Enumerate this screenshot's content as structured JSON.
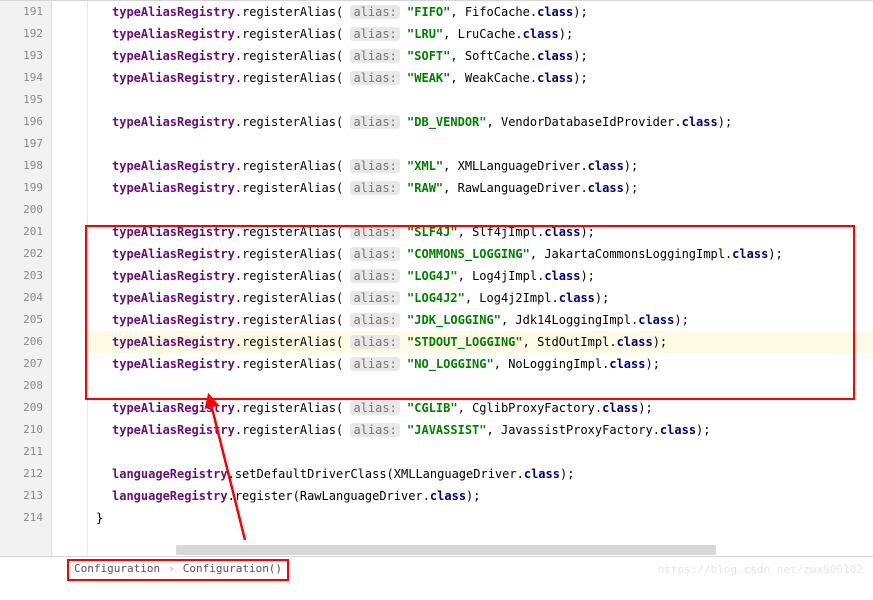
{
  "watermark": "https://blog.csdn.net/zwx900102",
  "breadcrumb": {
    "items": [
      "Configuration",
      "Configuration()"
    ]
  },
  "gutter": {
    "start": 191,
    "end": 214
  },
  "hints": {
    "alias": "alias:"
  },
  "code": [
    {
      "n": 191,
      "seg": [
        {
          "t": "field",
          "v": "typeAliasRegistry"
        },
        {
          "t": "p",
          "v": "."
        },
        {
          "t": "m",
          "v": "registerAlias"
        },
        {
          "t": "p",
          "v": "( "
        },
        {
          "t": "hint",
          "v": "alias"
        },
        {
          "t": "p",
          "v": " "
        },
        {
          "t": "s",
          "v": "\"FIFO\""
        },
        {
          "t": "p",
          "v": ", "
        },
        {
          "t": "c",
          "v": "FifoCache"
        },
        {
          "t": "p",
          "v": "."
        },
        {
          "t": "k",
          "v": "class"
        },
        {
          "t": "p",
          "v": ");"
        }
      ]
    },
    {
      "n": 192,
      "seg": [
        {
          "t": "field",
          "v": "typeAliasRegistry"
        },
        {
          "t": "p",
          "v": "."
        },
        {
          "t": "m",
          "v": "registerAlias"
        },
        {
          "t": "p",
          "v": "( "
        },
        {
          "t": "hint",
          "v": "alias"
        },
        {
          "t": "p",
          "v": " "
        },
        {
          "t": "s",
          "v": "\"LRU\""
        },
        {
          "t": "p",
          "v": ", "
        },
        {
          "t": "c",
          "v": "LruCache"
        },
        {
          "t": "p",
          "v": "."
        },
        {
          "t": "k",
          "v": "class"
        },
        {
          "t": "p",
          "v": ");"
        }
      ]
    },
    {
      "n": 193,
      "seg": [
        {
          "t": "field",
          "v": "typeAliasRegistry"
        },
        {
          "t": "p",
          "v": "."
        },
        {
          "t": "m",
          "v": "registerAlias"
        },
        {
          "t": "p",
          "v": "( "
        },
        {
          "t": "hint",
          "v": "alias"
        },
        {
          "t": "p",
          "v": " "
        },
        {
          "t": "s",
          "v": "\"SOFT\""
        },
        {
          "t": "p",
          "v": ", "
        },
        {
          "t": "c",
          "v": "SoftCache"
        },
        {
          "t": "p",
          "v": "."
        },
        {
          "t": "k",
          "v": "class"
        },
        {
          "t": "p",
          "v": ");"
        }
      ]
    },
    {
      "n": 194,
      "seg": [
        {
          "t": "field",
          "v": "typeAliasRegistry"
        },
        {
          "t": "p",
          "v": "."
        },
        {
          "t": "m",
          "v": "registerAlias"
        },
        {
          "t": "p",
          "v": "( "
        },
        {
          "t": "hint",
          "v": "alias"
        },
        {
          "t": "p",
          "v": " "
        },
        {
          "t": "s",
          "v": "\"WEAK\""
        },
        {
          "t": "p",
          "v": ", "
        },
        {
          "t": "c",
          "v": "WeakCache"
        },
        {
          "t": "p",
          "v": "."
        },
        {
          "t": "k",
          "v": "class"
        },
        {
          "t": "p",
          "v": ");"
        }
      ]
    },
    {
      "n": 195,
      "seg": []
    },
    {
      "n": 196,
      "seg": [
        {
          "t": "field",
          "v": "typeAliasRegistry"
        },
        {
          "t": "p",
          "v": "."
        },
        {
          "t": "m",
          "v": "registerAlias"
        },
        {
          "t": "p",
          "v": "( "
        },
        {
          "t": "hint",
          "v": "alias"
        },
        {
          "t": "p",
          "v": " "
        },
        {
          "t": "s",
          "v": "\"DB_VENDOR\""
        },
        {
          "t": "p",
          "v": ", "
        },
        {
          "t": "c",
          "v": "VendorDatabaseIdProvider"
        },
        {
          "t": "p",
          "v": "."
        },
        {
          "t": "k",
          "v": "class"
        },
        {
          "t": "p",
          "v": ");"
        }
      ]
    },
    {
      "n": 197,
      "seg": []
    },
    {
      "n": 198,
      "seg": [
        {
          "t": "field",
          "v": "typeAliasRegistry"
        },
        {
          "t": "p",
          "v": "."
        },
        {
          "t": "m",
          "v": "registerAlias"
        },
        {
          "t": "p",
          "v": "( "
        },
        {
          "t": "hint",
          "v": "alias"
        },
        {
          "t": "p",
          "v": " "
        },
        {
          "t": "s",
          "v": "\"XML\""
        },
        {
          "t": "p",
          "v": ", "
        },
        {
          "t": "c",
          "v": "XMLLanguageDriver"
        },
        {
          "t": "p",
          "v": "."
        },
        {
          "t": "k",
          "v": "class"
        },
        {
          "t": "p",
          "v": ");"
        }
      ]
    },
    {
      "n": 199,
      "seg": [
        {
          "t": "field",
          "v": "typeAliasRegistry"
        },
        {
          "t": "p",
          "v": "."
        },
        {
          "t": "m",
          "v": "registerAlias"
        },
        {
          "t": "p",
          "v": "( "
        },
        {
          "t": "hint",
          "v": "alias"
        },
        {
          "t": "p",
          "v": " "
        },
        {
          "t": "s",
          "v": "\"RAW\""
        },
        {
          "t": "p",
          "v": ", "
        },
        {
          "t": "c",
          "v": "RawLanguageDriver"
        },
        {
          "t": "p",
          "v": "."
        },
        {
          "t": "k",
          "v": "class"
        },
        {
          "t": "p",
          "v": ");"
        }
      ]
    },
    {
      "n": 200,
      "seg": []
    },
    {
      "n": 201,
      "seg": [
        {
          "t": "field",
          "v": "typeAliasRegistry"
        },
        {
          "t": "p",
          "v": "."
        },
        {
          "t": "m",
          "v": "registerAlias"
        },
        {
          "t": "p",
          "v": "( "
        },
        {
          "t": "hint",
          "v": "alias"
        },
        {
          "t": "p",
          "v": " "
        },
        {
          "t": "s",
          "v": "\"SLF4J\""
        },
        {
          "t": "p",
          "v": ", "
        },
        {
          "t": "c",
          "v": "Slf4jImpl"
        },
        {
          "t": "p",
          "v": "."
        },
        {
          "t": "k",
          "v": "class"
        },
        {
          "t": "p",
          "v": ");"
        }
      ]
    },
    {
      "n": 202,
      "seg": [
        {
          "t": "field",
          "v": "typeAliasRegistry"
        },
        {
          "t": "p",
          "v": "."
        },
        {
          "t": "m",
          "v": "registerAlias"
        },
        {
          "t": "p",
          "v": "( "
        },
        {
          "t": "hint",
          "v": "alias"
        },
        {
          "t": "p",
          "v": " "
        },
        {
          "t": "s",
          "v": "\"COMMONS_LOGGING\""
        },
        {
          "t": "p",
          "v": ", "
        },
        {
          "t": "c",
          "v": "JakartaCommonsLoggingImpl"
        },
        {
          "t": "p",
          "v": "."
        },
        {
          "t": "k",
          "v": "class"
        },
        {
          "t": "p",
          "v": ");"
        }
      ]
    },
    {
      "n": 203,
      "seg": [
        {
          "t": "field",
          "v": "typeAliasRegistry"
        },
        {
          "t": "p",
          "v": "."
        },
        {
          "t": "m",
          "v": "registerAlias"
        },
        {
          "t": "p",
          "v": "( "
        },
        {
          "t": "hint",
          "v": "alias"
        },
        {
          "t": "p",
          "v": " "
        },
        {
          "t": "s",
          "v": "\"LOG4J\""
        },
        {
          "t": "p",
          "v": ", "
        },
        {
          "t": "c",
          "v": "Log4jImpl"
        },
        {
          "t": "p",
          "v": "."
        },
        {
          "t": "k",
          "v": "class"
        },
        {
          "t": "p",
          "v": ");"
        }
      ]
    },
    {
      "n": 204,
      "seg": [
        {
          "t": "field",
          "v": "typeAliasRegistry"
        },
        {
          "t": "p",
          "v": "."
        },
        {
          "t": "m",
          "v": "registerAlias"
        },
        {
          "t": "p",
          "v": "( "
        },
        {
          "t": "hint",
          "v": "alias"
        },
        {
          "t": "p",
          "v": " "
        },
        {
          "t": "s",
          "v": "\"LOG4J2\""
        },
        {
          "t": "p",
          "v": ", "
        },
        {
          "t": "c",
          "v": "Log4j2Impl"
        },
        {
          "t": "p",
          "v": "."
        },
        {
          "t": "k",
          "v": "class"
        },
        {
          "t": "p",
          "v": ");"
        }
      ]
    },
    {
      "n": 205,
      "seg": [
        {
          "t": "field",
          "v": "typeAliasRegistry"
        },
        {
          "t": "p",
          "v": "."
        },
        {
          "t": "m",
          "v": "registerAlias"
        },
        {
          "t": "p",
          "v": "( "
        },
        {
          "t": "hint",
          "v": "alias"
        },
        {
          "t": "p",
          "v": " "
        },
        {
          "t": "s",
          "v": "\"JDK_LOGGING\""
        },
        {
          "t": "p",
          "v": ", "
        },
        {
          "t": "c",
          "v": "Jdk14LoggingImpl"
        },
        {
          "t": "p",
          "v": "."
        },
        {
          "t": "k",
          "v": "class"
        },
        {
          "t": "p",
          "v": ");"
        }
      ]
    },
    {
      "n": 206,
      "hl": true,
      "seg": [
        {
          "t": "field",
          "v": "typeAliasRegistry"
        },
        {
          "t": "p",
          "v": "."
        },
        {
          "t": "m",
          "v": "registerAlias"
        },
        {
          "t": "p",
          "v": "( "
        },
        {
          "t": "hint",
          "v": "alias"
        },
        {
          "t": "p",
          "v": " "
        },
        {
          "t": "s",
          "v": "\"STDOUT_LOGGING\""
        },
        {
          "t": "p",
          "v": ", "
        },
        {
          "t": "c",
          "v": "StdOutImpl"
        },
        {
          "t": "p",
          "v": "."
        },
        {
          "t": "k",
          "v": "class"
        },
        {
          "t": "p",
          "v": ");"
        }
      ]
    },
    {
      "n": 207,
      "seg": [
        {
          "t": "field",
          "v": "typeAliasRegistry"
        },
        {
          "t": "p",
          "v": "."
        },
        {
          "t": "m",
          "v": "registerAlias"
        },
        {
          "t": "p",
          "v": "( "
        },
        {
          "t": "hint",
          "v": "alias"
        },
        {
          "t": "p",
          "v": " "
        },
        {
          "t": "s",
          "v": "\"NO_LOGGING\""
        },
        {
          "t": "p",
          "v": ", "
        },
        {
          "t": "c",
          "v": "NoLoggingImpl"
        },
        {
          "t": "p",
          "v": "."
        },
        {
          "t": "k",
          "v": "class"
        },
        {
          "t": "p",
          "v": ");"
        }
      ]
    },
    {
      "n": 208,
      "seg": []
    },
    {
      "n": 209,
      "seg": [
        {
          "t": "field",
          "v": "typeAliasRegistry"
        },
        {
          "t": "p",
          "v": "."
        },
        {
          "t": "m",
          "v": "registerAlias"
        },
        {
          "t": "p",
          "v": "( "
        },
        {
          "t": "hint",
          "v": "alias"
        },
        {
          "t": "p",
          "v": " "
        },
        {
          "t": "s",
          "v": "\"CGLIB\""
        },
        {
          "t": "p",
          "v": ", "
        },
        {
          "t": "c",
          "v": "CglibProxyFactory"
        },
        {
          "t": "p",
          "v": "."
        },
        {
          "t": "k",
          "v": "class"
        },
        {
          "t": "p",
          "v": ");"
        }
      ]
    },
    {
      "n": 210,
      "seg": [
        {
          "t": "field",
          "v": "typeAliasRegistry"
        },
        {
          "t": "p",
          "v": "."
        },
        {
          "t": "m",
          "v": "registerAlias"
        },
        {
          "t": "p",
          "v": "( "
        },
        {
          "t": "hint",
          "v": "alias"
        },
        {
          "t": "p",
          "v": " "
        },
        {
          "t": "s",
          "v": "\"JAVASSIST\""
        },
        {
          "t": "p",
          "v": ", "
        },
        {
          "t": "c",
          "v": "JavassistProxyFactory"
        },
        {
          "t": "p",
          "v": "."
        },
        {
          "t": "k",
          "v": "class"
        },
        {
          "t": "p",
          "v": ");"
        }
      ]
    },
    {
      "n": 211,
      "seg": []
    },
    {
      "n": 212,
      "seg": [
        {
          "t": "field",
          "v": "languageRegistry"
        },
        {
          "t": "p",
          "v": "."
        },
        {
          "t": "m",
          "v": "setDefaultDriverClass"
        },
        {
          "t": "p",
          "v": "("
        },
        {
          "t": "c",
          "v": "XMLLanguageDriver"
        },
        {
          "t": "p",
          "v": "."
        },
        {
          "t": "k",
          "v": "class"
        },
        {
          "t": "p",
          "v": ");"
        }
      ]
    },
    {
      "n": 213,
      "seg": [
        {
          "t": "field",
          "v": "languageRegistry"
        },
        {
          "t": "p",
          "v": "."
        },
        {
          "t": "m",
          "v": "register"
        },
        {
          "t": "p",
          "v": "("
        },
        {
          "t": "c",
          "v": "RawLanguageDriver"
        },
        {
          "t": "p",
          "v": "."
        },
        {
          "t": "k",
          "v": "class"
        },
        {
          "t": "p",
          "v": ");"
        }
      ]
    },
    {
      "n": 214,
      "brace": true,
      "seg": [
        {
          "t": "p",
          "v": "}"
        }
      ]
    }
  ]
}
